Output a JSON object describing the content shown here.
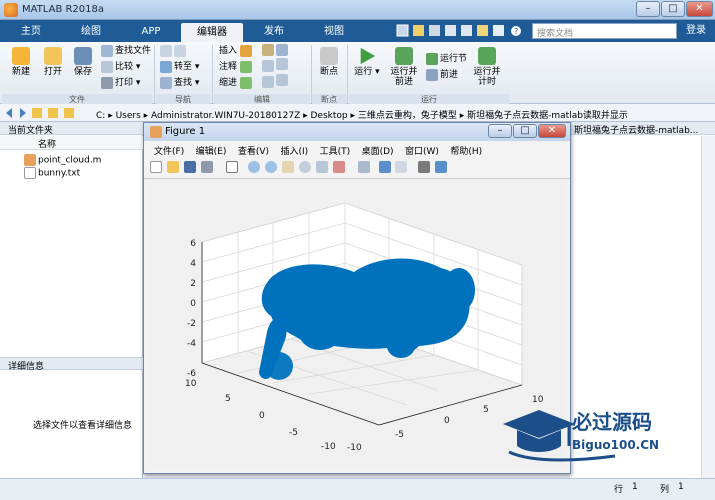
{
  "app": {
    "title": "MATLAB R2018a"
  },
  "window_controls": {
    "minimize": "–",
    "maximize": "□",
    "close": "✕"
  },
  "tabs": [
    {
      "label": "主页"
    },
    {
      "label": "绘图"
    },
    {
      "label": "APP"
    },
    {
      "label": "编辑器",
      "active": true
    },
    {
      "label": "发布"
    },
    {
      "label": "视图"
    }
  ],
  "search": {
    "placeholder": "搜索文档"
  },
  "login": {
    "label": "登录"
  },
  "ribbon": {
    "file": {
      "new": "新建",
      "open": "打开",
      "save": "保存",
      "find_files": "查找文件",
      "compare": "比较",
      "print": "打印",
      "group": "文件"
    },
    "navigate": {
      "goto": "转至",
      "find": "查找",
      "group": "导航"
    },
    "edit": {
      "insert": "插入",
      "comment": "注释",
      "indent": "缩进",
      "group": "编辑"
    },
    "breakpoints": {
      "label": "断点",
      "group": "断点"
    },
    "run": {
      "run": "运行",
      "run_advance": "运行并\n前进",
      "run_section": "运行节",
      "advance": "前进",
      "run_time": "运行并\n计时",
      "group": "运行"
    }
  },
  "address": {
    "crumbs": [
      "C:",
      "Users",
      "Administrator.WIN7U-20180127Z",
      "Desktop",
      "三维点云重构，兔子模型",
      "斯坦福兔子点云数据-matlab读取并显示"
    ]
  },
  "left_panel": {
    "title": "当前文件夹",
    "column": "名称",
    "files": [
      {
        "name": "point_cloud.m",
        "icon": "m-file-icon"
      },
      {
        "name": "bunny.txt",
        "icon": "text-file-icon"
      }
    ],
    "details_title": "详细信息",
    "details_text": "选择文件以查看详细信息"
  },
  "right_panel": {
    "title": "斯坦福兔子点云数据-matlab..."
  },
  "figure": {
    "title": "Figure 1",
    "menu": [
      "文件(F)",
      "编辑(E)",
      "查看(V)",
      "插入(I)",
      "工具(T)",
      "桌面(D)",
      "窗口(W)",
      "帮助(H)"
    ]
  },
  "chart_data": {
    "type": "scatter",
    "title": "",
    "xlabel": "",
    "ylabel": "",
    "zlabel": "",
    "zlim": [
      -6,
      6
    ],
    "z_ticks": [
      "6",
      "4",
      "2",
      "0",
      "-2",
      "-4",
      "-6"
    ],
    "x_ticks": [
      "10",
      "5",
      "0",
      "-5",
      "-10"
    ],
    "y_ticks": [
      "-10",
      "-5",
      "0",
      "5",
      "10"
    ],
    "grid": true,
    "marker_color": "#0072BD"
  },
  "status": {
    "row_label": "行",
    "row": "1",
    "col_label": "列",
    "col": "1"
  },
  "watermark": {
    "text": "必过源码",
    "url": "Biguo100.CN"
  },
  "colors": {
    "tab_bar": "#1f5c97",
    "accent": "#0072BD"
  }
}
